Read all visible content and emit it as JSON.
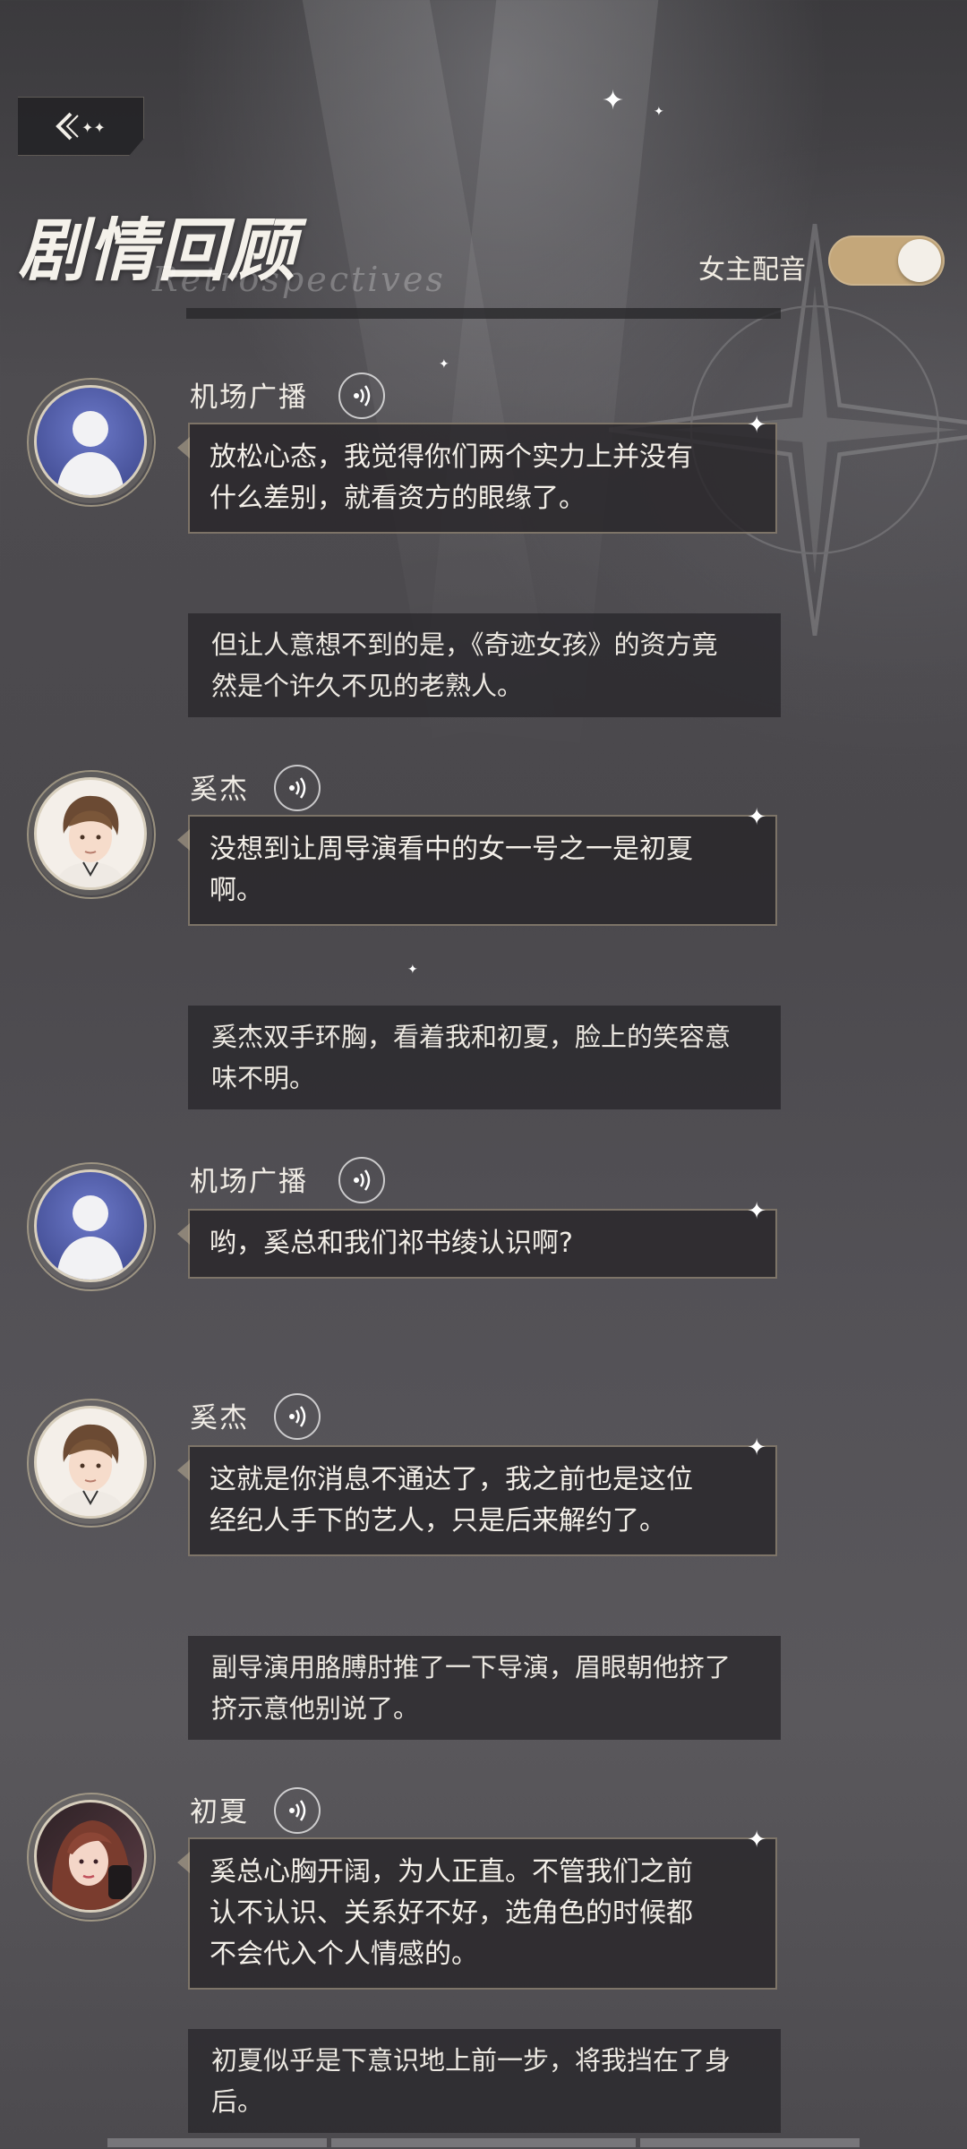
{
  "header": {
    "title": "剧情回顾",
    "subtitle": "Retrospectives",
    "voice_toggle_label": "女主配音",
    "voice_toggle_on": true
  },
  "entries": [
    {
      "type": "dialogue",
      "speaker": "机场广播",
      "avatar": "silhouette",
      "lines": [
        "放松心态，我觉得你们两个实力上并没有",
        "什么差别，就看资方的眼缘了。"
      ]
    },
    {
      "type": "narration",
      "lines": [
        "但让人意想不到的是，《奇迹女孩》的资方竟",
        "然是个许久不见的老熟人。"
      ]
    },
    {
      "type": "dialogue",
      "speaker": "奚杰",
      "avatar": "male",
      "lines": [
        "没想到让周导演看中的女一号之一是初夏",
        "啊。"
      ]
    },
    {
      "type": "narration",
      "lines": [
        "奚杰双手环胸，看着我和初夏，脸上的笑容意",
        "味不明。"
      ]
    },
    {
      "type": "dialogue",
      "speaker": "机场广播",
      "avatar": "silhouette",
      "lines": [
        "哟，奚总和我们祁书绫认识啊?"
      ]
    },
    {
      "type": "dialogue",
      "speaker": "奚杰",
      "avatar": "male",
      "lines": [
        "这就是你消息不通达了，我之前也是这位",
        "经纪人手下的艺人，只是后来解约了。"
      ]
    },
    {
      "type": "narration",
      "lines": [
        "副导演用胳膊肘推了一下导演，眉眼朝他挤了",
        "挤示意他别说了。"
      ]
    },
    {
      "type": "dialogue",
      "speaker": "初夏",
      "avatar": "female",
      "lines": [
        "奚总心胸开阔，为人正直。不管我们之前",
        "认不认识、关系好不好，选角色的时候都",
        "不会代入个人情感的。"
      ]
    },
    {
      "type": "narration",
      "lines": [
        "初夏似乎是下意识地上前一步，将我挡在了身",
        "后。"
      ]
    }
  ],
  "colors": {
    "accent_gold": "#c4a77a",
    "bubble_border": "#beaf96",
    "text": "#f3efe8"
  }
}
